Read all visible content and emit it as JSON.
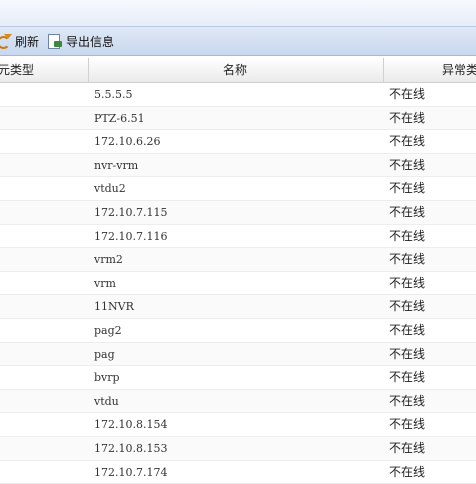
{
  "toolbar": {
    "refresh_label": "刷新",
    "export_label": "导出信息"
  },
  "table": {
    "columns": [
      "元类型",
      "名称",
      "异常类"
    ],
    "rows": [
      {
        "name": "5.5.5.5",
        "status": "不在线"
      },
      {
        "name": "PTZ-6.51",
        "status": "不在线"
      },
      {
        "name": "172.10.6.26",
        "status": "不在线"
      },
      {
        "name": "nvr-vrm",
        "status": "不在线"
      },
      {
        "name": "vtdu2",
        "status": "不在线"
      },
      {
        "name": "172.10.7.115",
        "status": "不在线"
      },
      {
        "name": "172.10.7.116",
        "status": "不在线"
      },
      {
        "name": "vrm2",
        "status": "不在线"
      },
      {
        "name": "vrm",
        "status": "不在线"
      },
      {
        "name": "11NVR",
        "status": "不在线"
      },
      {
        "name": "pag2",
        "status": "不在线"
      },
      {
        "name": "pag",
        "status": "不在线"
      },
      {
        "name": "bvrp",
        "status": "不在线"
      },
      {
        "name": "vtdu",
        "status": "不在线"
      },
      {
        "name": "172.10.8.154",
        "status": "不在线"
      },
      {
        "name": "172.10.8.153",
        "status": "不在线"
      },
      {
        "name": "172.10.7.174",
        "status": "不在线"
      }
    ]
  },
  "icons": {
    "refresh": "refresh-icon",
    "export": "export-icon"
  }
}
